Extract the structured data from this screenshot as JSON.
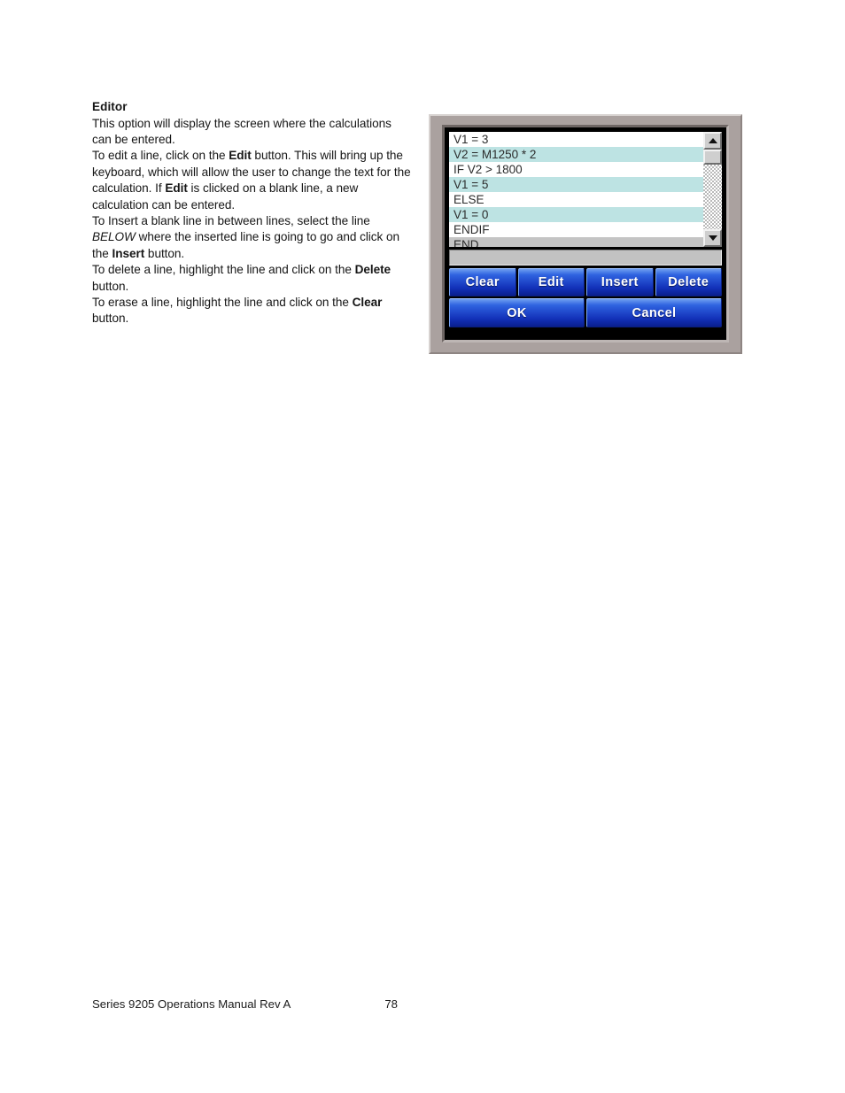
{
  "document": {
    "section_heading": "Editor",
    "paragraphs": [
      "This option will display the screen where the calculations can be entered.",
      "To edit a line, click on the Edit button.  This will bring up the keyboard, which will allow the user to change the text for the calculation.  If Edit is clicked on a blank line, a new calculation can be entered.",
      "To Insert a blank line in between lines, select the line BELOW where the inserted line is going to go and click on the Insert button.",
      "To delete a line, highlight the line and click on the Delete button.",
      "To erase a line, highlight the line and click on the Clear button."
    ],
    "para1": {
      "t1": "This option will display the screen where the calculations can be entered."
    },
    "para2": {
      "t1": "To edit a line, click on the ",
      "b1": "Edit",
      "t2": " button.  This will bring up the keyboard, which will allow the user to change the text for the calculation.  If ",
      "b2": "Edit",
      "t3": " is clicked on a blank line, a new calculation can be entered."
    },
    "para3": {
      "t1": "To Insert a blank line in between lines, select the line ",
      "i1": "BELOW",
      "t2": " where the inserted line is going to go and click on the ",
      "b1": "Insert",
      "t3": " button."
    },
    "para4": {
      "t1": "To delete a line, highlight the line and click on the ",
      "b1": "Delete",
      "t2": " button."
    },
    "para5": {
      "t1": "To erase a line, highlight the line and click on the ",
      "b1": "Clear",
      "t2": " button."
    }
  },
  "device": {
    "editor_list": {
      "lines": [
        {
          "text": "V1 = 3",
          "state": "normal"
        },
        {
          "text": "V2 = M1250 * 2",
          "state": "highlight"
        },
        {
          "text": "IF V2 > 1800",
          "state": "normal"
        },
        {
          "text": "V1 = 5",
          "state": "highlight"
        },
        {
          "text": "ELSE",
          "state": "normal"
        },
        {
          "text": "V1 = 0",
          "state": "highlight"
        },
        {
          "text": "ENDIF",
          "state": "normal"
        },
        {
          "text": "END",
          "state": "selected"
        }
      ]
    },
    "scrollbar": {
      "up_icon": "triangle-up-icon",
      "down_icon": "triangle-down-icon"
    },
    "status_bar_text": "",
    "buttons_row1": [
      {
        "label": "Clear"
      },
      {
        "label": "Edit"
      },
      {
        "label": "Insert"
      },
      {
        "label": "Delete"
      }
    ],
    "buttons_row2": [
      {
        "label": "OK"
      },
      {
        "label": "Cancel"
      }
    ],
    "colors": {
      "bezel": "#aaa19f",
      "screen_bg": "#000000",
      "list_bg": "#ffffff",
      "row_highlight": "#bde3e3",
      "row_selected": "#c4c4c4",
      "button_blue_top": "#6e9ef0",
      "button_blue_bottom": "#0a1f8e",
      "status_bar": "#c2c2c2"
    }
  },
  "footer": {
    "manual_title": "Series 9205 Operations Manual Rev A",
    "page_number": "78"
  }
}
